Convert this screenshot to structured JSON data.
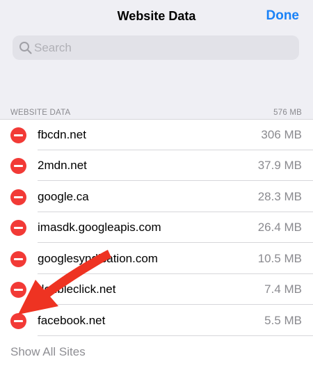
{
  "nav": {
    "title": "Website Data",
    "done_label": "Done"
  },
  "search": {
    "placeholder": "Search",
    "value": ""
  },
  "section": {
    "title": "WEBSITE DATA",
    "total": "576 MB"
  },
  "sites": [
    {
      "name": "fbcdn.net",
      "size": "306 MB"
    },
    {
      "name": "2mdn.net",
      "size": "37.9 MB"
    },
    {
      "name": "google.ca",
      "size": "28.3 MB"
    },
    {
      "name": "imasdk.googleapis.com",
      "size": "26.4 MB"
    },
    {
      "name": "googlesyndication.com",
      "size": "10.5 MB"
    },
    {
      "name": "doubleclick.net",
      "size": "7.4 MB"
    },
    {
      "name": "facebook.net",
      "size": "5.5 MB"
    }
  ],
  "footer": {
    "show_all_label": "Show All Sites"
  },
  "colors": {
    "accent": "#1a82f7",
    "delete": "#f23a36",
    "annotation_arrow": "#ee3322"
  },
  "icons": {
    "search": "search-icon",
    "delete": "minus-circle-icon",
    "annotation": "arrow-annotation-icon"
  }
}
